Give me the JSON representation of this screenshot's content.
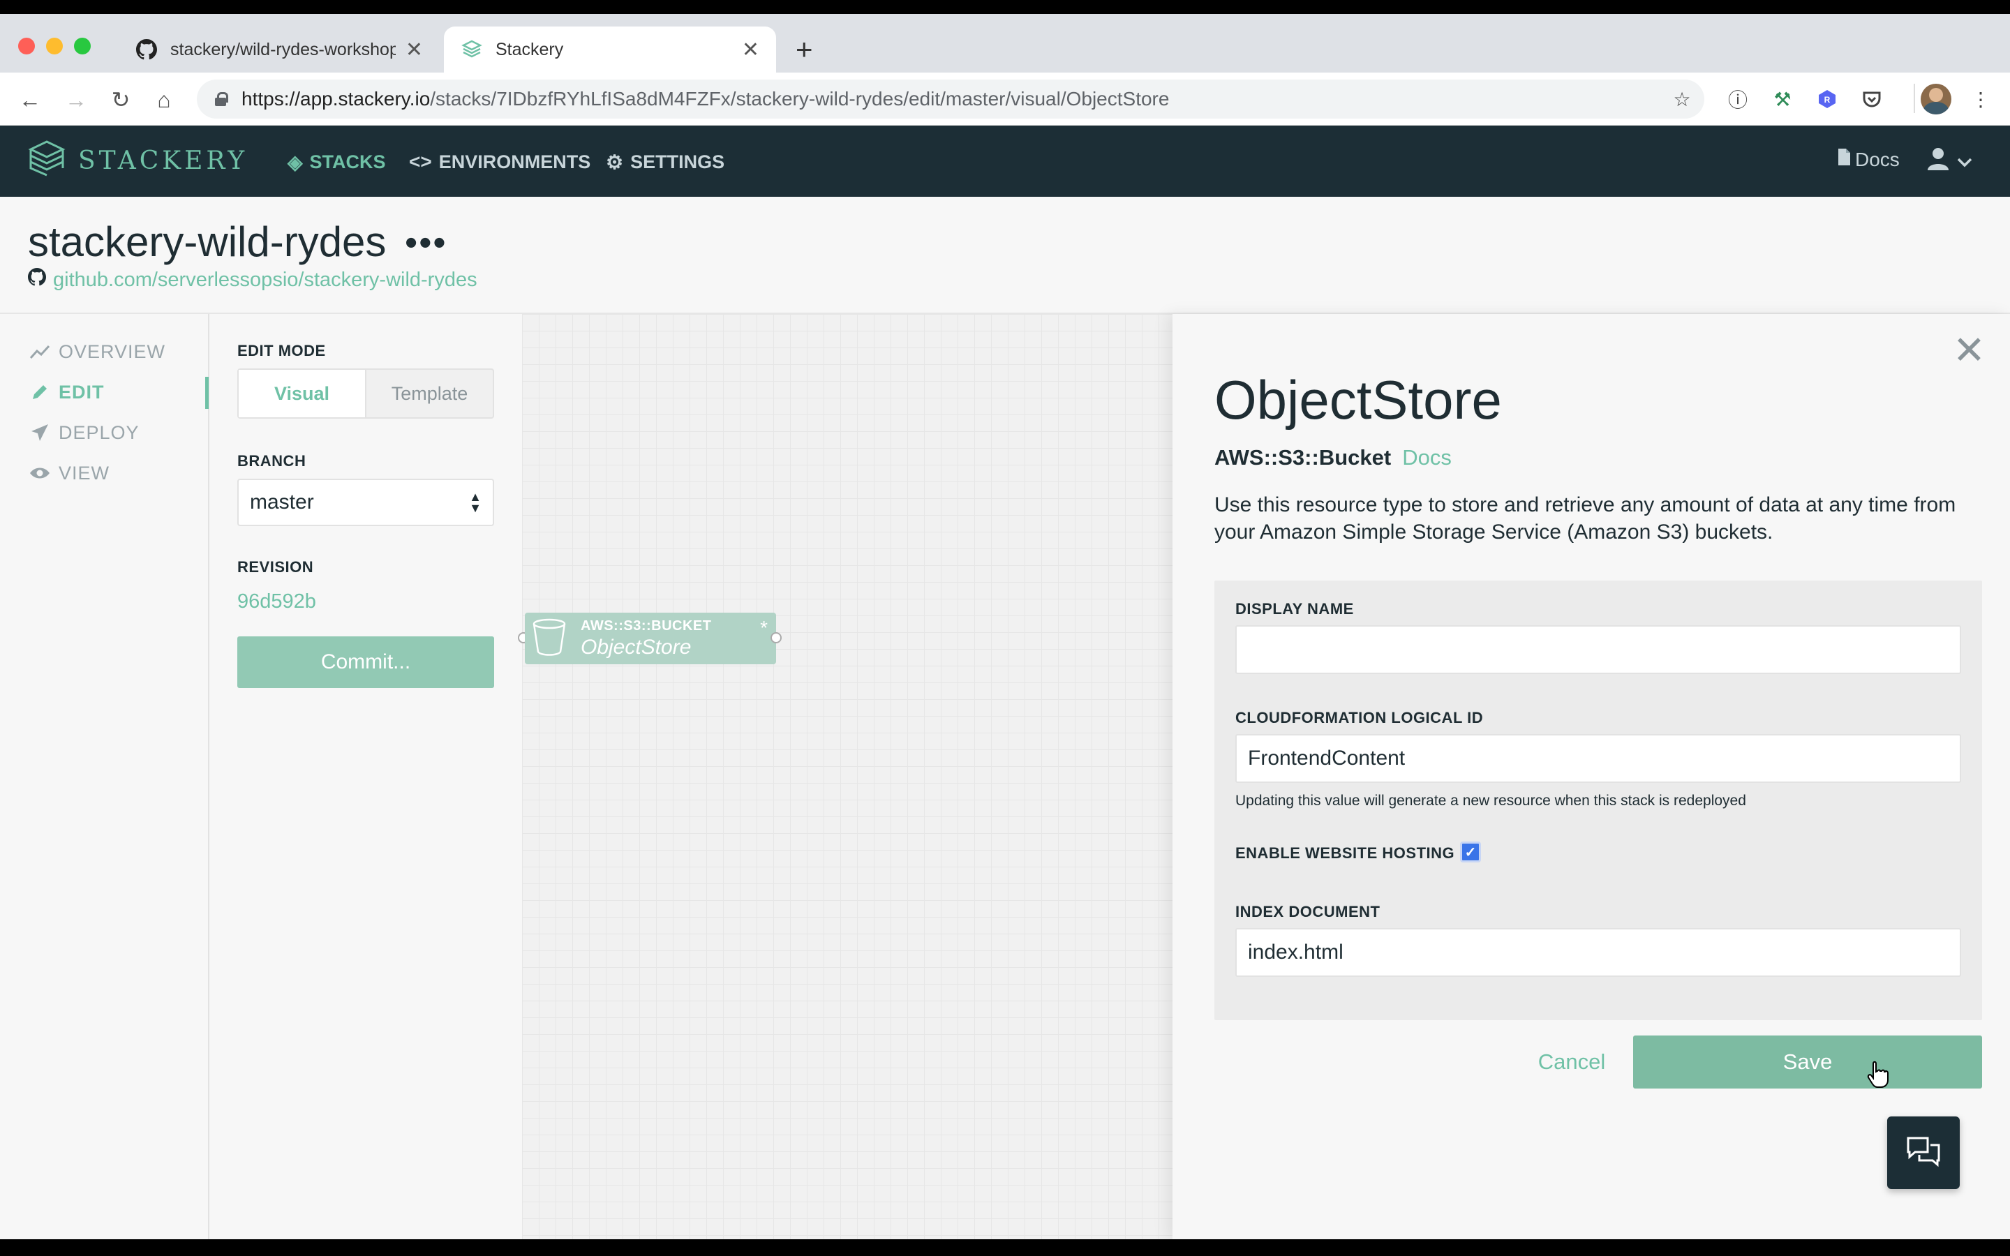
{
  "browser": {
    "tabs": [
      {
        "title": "stackery/wild-rydes-workshop",
        "icon": "github-icon"
      },
      {
        "title": "Stackery",
        "icon": "stackery-icon"
      }
    ],
    "url_host": "https://app.stackery.io",
    "url_path": "/stacks/7IDbzfRYhLfISa8dM4FZFx/stackery-wild-rydes/edit/master/visual/ObjectStore"
  },
  "header": {
    "logo": "STACKERY",
    "nav": [
      {
        "label": "STACKS",
        "icon": "layers-icon"
      },
      {
        "label": "ENVIRONMENTS",
        "icon": "code-icon"
      },
      {
        "label": "SETTINGS",
        "icon": "gear-icon"
      }
    ],
    "docs": "Docs"
  },
  "stack": {
    "title": "stackery-wild-rydes",
    "more": "•••",
    "repo": "github.com/serverlessopsio/stackery-wild-rydes"
  },
  "sidebar": {
    "items": [
      {
        "label": "OVERVIEW",
        "icon": "chart-line-icon"
      },
      {
        "label": "EDIT",
        "icon": "pencil-icon"
      },
      {
        "label": "DEPLOY",
        "icon": "paper-plane-icon"
      },
      {
        "label": "VIEW",
        "icon": "eye-icon"
      }
    ]
  },
  "edit_panel": {
    "mode_label": "EDIT MODE",
    "mode_visual": "Visual",
    "mode_template": "Template",
    "branch_label": "BRANCH",
    "branch_value": "master",
    "revision_label": "REVISION",
    "revision_value": "96d592b",
    "commit_label": "Commit..."
  },
  "canvas": {
    "node_type": "AWS::S3::BUCKET",
    "node_name": "ObjectStore",
    "node_dirty": "*"
  },
  "resource_panel": {
    "title": "ObjectStore",
    "type": "AWS::S3::Bucket",
    "docs": "Docs",
    "description": "Use this resource type to store and retrieve any amount of data at any time from your Amazon Simple Storage Service (Amazon S3) buckets.",
    "display_name_label": "DISPLAY NAME",
    "display_name_value": "",
    "logical_id_label": "CLOUDFORMATION LOGICAL ID",
    "logical_id_value": "FrontendContent",
    "logical_id_help": "Updating this value will generate a new resource when this stack is redeployed",
    "hosting_label": "ENABLE WEBSITE HOSTING",
    "hosting_checked": true,
    "index_label": "INDEX DOCUMENT",
    "index_value": "index.html",
    "cancel": "Cancel",
    "save": "Save"
  },
  "colors": {
    "accent": "#6fc1a6",
    "header_bg": "#1c2e36",
    "checkbox": "#3a74e8"
  }
}
